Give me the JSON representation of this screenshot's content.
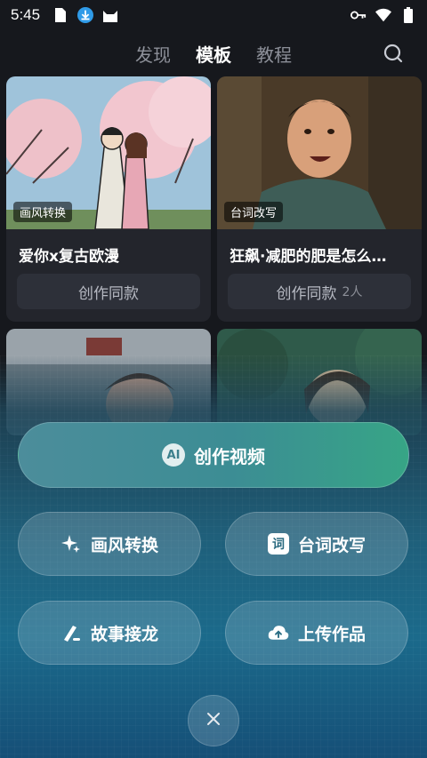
{
  "status_bar": {
    "time": "5:45",
    "left_icons": [
      "sim-card-icon",
      "download-icon",
      "cat-app-icon"
    ],
    "right_icons": [
      "key-icon",
      "wifi-icon",
      "battery-icon"
    ]
  },
  "top_nav": {
    "tabs": [
      {
        "label": "发现",
        "active": false
      },
      {
        "label": "模板",
        "active": true
      },
      {
        "label": "教程",
        "active": false
      }
    ],
    "search_icon": "search-icon"
  },
  "cards": [
    {
      "badge": "画风转换",
      "title": "爱你x复古欧漫",
      "cta": "创作同款",
      "count": ""
    },
    {
      "badge": "台词改写",
      "title": "狂飙·减肥的肥是怎么…",
      "cta": "创作同款",
      "count": "2人"
    }
  ],
  "actions": {
    "main": {
      "label": "创作视频",
      "icon": "ai-icon",
      "badge_text": "AI"
    },
    "style_transfer": {
      "label": "画风转换",
      "icon": "sparkle-icon"
    },
    "line_rewrite": {
      "label": "台词改写",
      "icon": "word-icon",
      "icon_text": "词"
    },
    "story_continue": {
      "label": "故事接龙",
      "icon": "pen-icon"
    },
    "upload": {
      "label": "上传作品",
      "icon": "cloud-upload-icon"
    }
  },
  "close": {
    "icon": "close-icon"
  }
}
